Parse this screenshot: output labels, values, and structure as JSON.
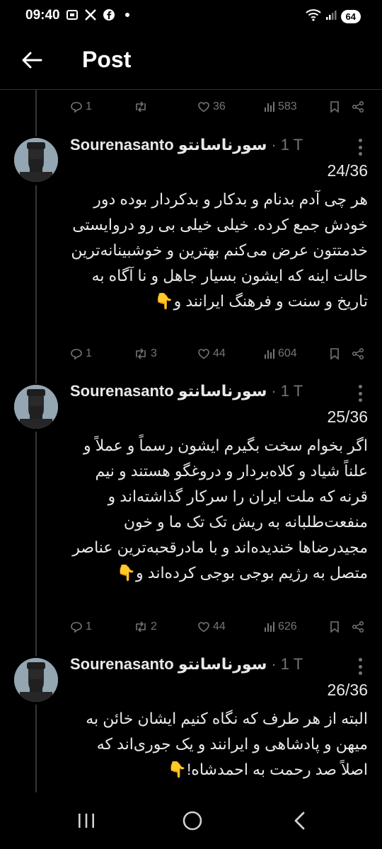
{
  "status_bar": {
    "time": "09:40",
    "battery": "64"
  },
  "header": {
    "title": "Post"
  },
  "prev_actions": {
    "replies": "1",
    "reposts": "",
    "likes": "36",
    "views": "583"
  },
  "tweets": [
    {
      "name": "Sourenasanto سورناسانتو",
      "meta": "· 1 T",
      "counter": "24/36",
      "text": "هر چی آدم بدنام و بدکار و بدکردار بوده دور خودش جمع کرده. خیلی خیلی بی رو دروایستی خدمتتون عرض می‌کنم بهترین و خوشبینانه‌ترین حالت اینه که ایشون بسیار جاهل و نا آگاه به تاریخ و سنت و فرهنگ ایرانند و👇",
      "replies": "1",
      "reposts": "3",
      "likes": "44",
      "views": "604"
    },
    {
      "name": "Sourenasanto سورناسانتو",
      "meta": "· 1 T",
      "counter": "25/36",
      "text": "اگر بخوام سخت بگیرم ایشون رسماً و عملاً و علناً شیاد و کلاه‌بردار و دروغگو هستند و نیم قرنه که ملت ایران را سرکار گذاشته‌اند و منفعت‌طلبانه به ریش تک تک ما و خون مجیدرضاها خندیده‌اند و با مادرقحبه‌ترین عناصر متصل به رژیم بوجی بوجی کرده‌اند و👇",
      "replies": "1",
      "reposts": "2",
      "likes": "44",
      "views": "626"
    },
    {
      "name": "Sourenasanto سورناسانتو",
      "meta": "· 1 T",
      "counter": "26/36",
      "text": "البته از هر طرف که نگاه کنیم ایشان خائن به میهن و پادشاهی و ایرانند و یک جوری‌اند که اصلاً صد رحمت به احمدشاه!👇"
    }
  ],
  "colors": {
    "background": "#000000",
    "text": "#e7e9ea",
    "muted": "#71767b",
    "divider": "#2f3336"
  },
  "icons": [
    "back-arrow-icon",
    "reply-icon",
    "repost-icon",
    "like-icon",
    "views-icon",
    "bookmark-icon",
    "share-icon",
    "more-icon"
  ]
}
